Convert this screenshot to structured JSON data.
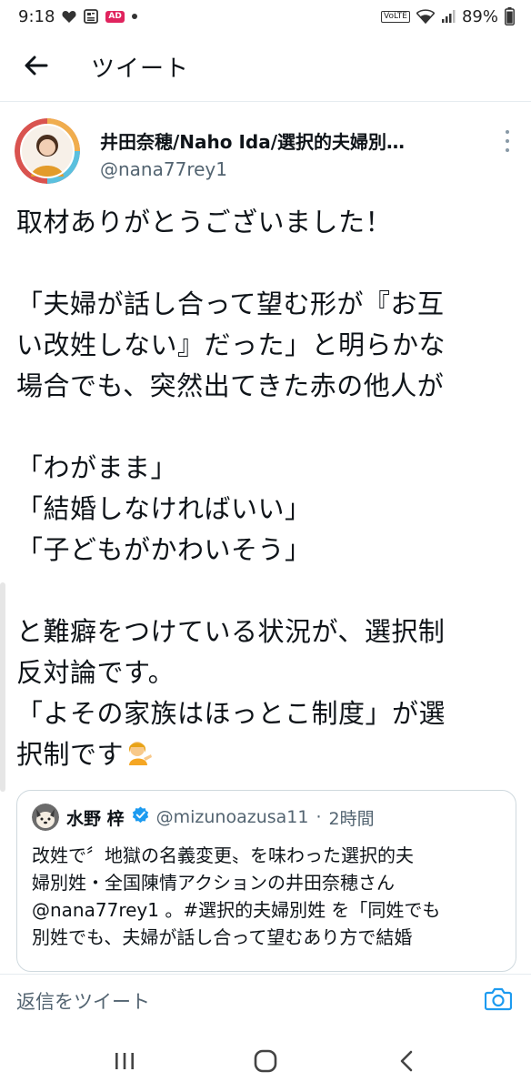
{
  "status_bar": {
    "time": "9:18",
    "ad_label": "AD",
    "volte_label": "VoLTE",
    "battery": "89%"
  },
  "app_bar": {
    "title": "ツイート"
  },
  "tweet": {
    "author_name": "井田奈穂/Naho Ida/選択的夫婦別…",
    "author_handle": "@nana77rey1",
    "lines": [
      "取材ありがとうございました！",
      "",
      "「夫婦が話し合って望む形が『お互",
      "い改姓しない』だった」と明らかな",
      "場合でも、突然出てきた赤の他人が",
      "",
      "「わがまま」",
      "「結婚しなければいい」",
      "「子どもがかわいそう」",
      "",
      "と難癖をつけている状況が、選択制",
      "反対論です。",
      "「よその家族はほっとこ制度」が選",
      "択制です"
    ]
  },
  "quote": {
    "name": "水野 梓",
    "handle": "@mizunoazusa11",
    "separator": "·",
    "time": "2時間",
    "lines": [
      "改姓で〞地獄の名義変更〟を味わった選択的夫",
      "婦別姓・全国陳情アクションの井田奈穂さん",
      "@nana77rey1 。#選択的夫婦別姓 を「同姓でも",
      "別姓でも、夫婦が話し合って望むあり方で結婚"
    ]
  },
  "reply": {
    "placeholder": "返信をツイート"
  },
  "icons": {
    "back": "back-arrow-icon",
    "more": "more-vertical-icon",
    "camera": "camera-icon",
    "verified": "verified-badge-icon",
    "emoji": "person-tipping-hand-emoji"
  },
  "colors": {
    "accent": "#1d9bf0",
    "text": "#0f1419",
    "secondary": "#536471",
    "divider": "#e6ecf0"
  }
}
